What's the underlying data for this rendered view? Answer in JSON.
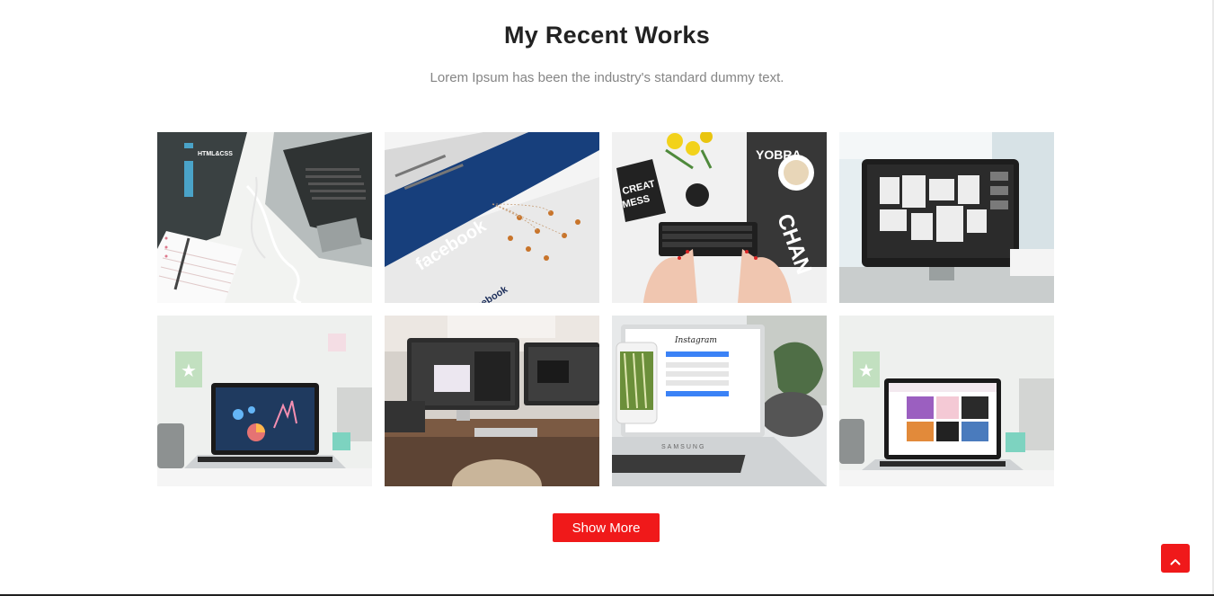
{
  "section": {
    "title": "My Recent Works",
    "subtitle": "Lorem Ipsum has been the industry's standard dummy text."
  },
  "works": [
    {
      "name": "portfolio-item-html-css-laptop",
      "icon": "laptop-book-photo"
    },
    {
      "name": "portfolio-item-facebook-screen",
      "icon": "facebook-screen-photo"
    },
    {
      "name": "portfolio-item-keyboard-desk",
      "icon": "keyboard-desk-photo"
    },
    {
      "name": "portfolio-item-imac-workspace",
      "icon": "imac-photo"
    },
    {
      "name": "portfolio-item-macbook-charts",
      "icon": "macbook-charts-photo"
    },
    {
      "name": "portfolio-item-dual-monitor-desk",
      "icon": "dual-monitor-photo"
    },
    {
      "name": "portfolio-item-instagram-laptop",
      "icon": "instagram-laptop-photo"
    },
    {
      "name": "portfolio-item-macbook-website",
      "icon": "macbook-website-photo"
    }
  ],
  "actions": {
    "show_more_label": "Show More",
    "back_to_top_icon": "chevron-up-icon"
  },
  "colors": {
    "accent": "#f0191a",
    "title": "#222222",
    "subtitle": "#858585"
  }
}
